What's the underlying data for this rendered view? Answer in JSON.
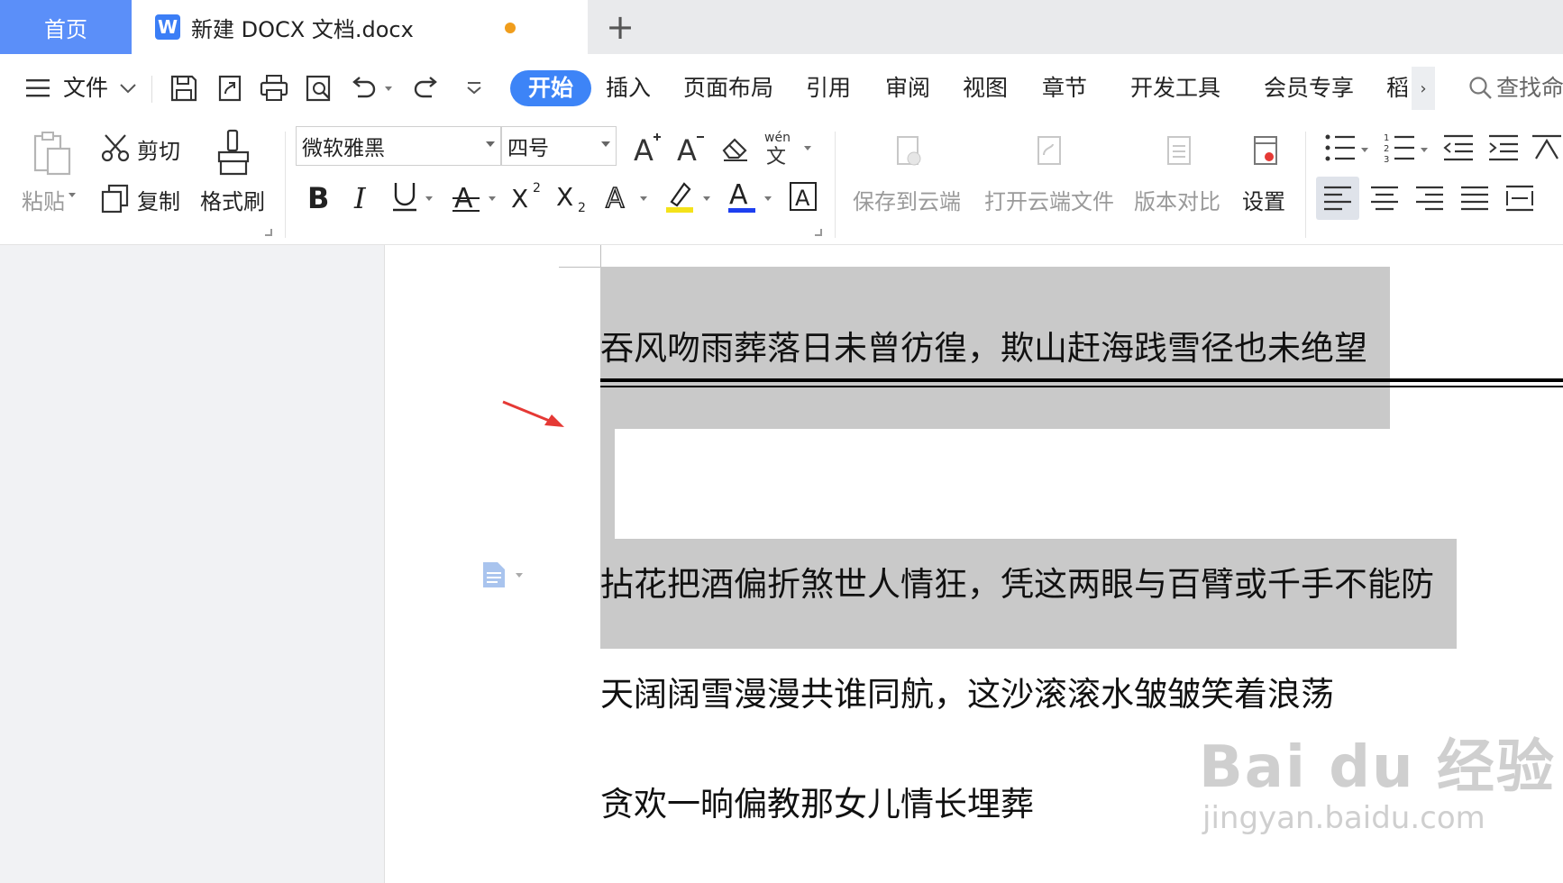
{
  "tabs": {
    "home": "首页",
    "document": "新建 DOCX 文档.docx",
    "add": "+"
  },
  "menu": {
    "file": "文件",
    "ribbon_tabs": [
      "开始",
      "插入",
      "页面布局",
      "引用",
      "审阅",
      "视图",
      "章节",
      "开发工具",
      "会员专享",
      "稻"
    ],
    "search": "查找命"
  },
  "ribbon": {
    "paste": "粘贴",
    "cut": "剪切",
    "copy": "复制",
    "format_painter": "格式刷",
    "font_name": "微软雅黑",
    "font_size": "四号",
    "save_cloud": "保存到云端",
    "open_cloud": "打开云端文件",
    "version_compare": "版本对比",
    "settings": "设置"
  },
  "document": {
    "lines": [
      "吞风吻雨葬落日未曾彷徨，欺山赶海践雪径也未绝望",
      "拈花把酒偏折煞世人情狂，凭这两眼与百臂或千手不能防",
      "天阔阔雪漫漫共谁同航，这沙滚滚水皱皱笑着浪荡",
      "贪欢一晌偏教那女儿情长埋葬"
    ]
  },
  "watermark": {
    "main": "Bai du 经验",
    "sub": "jingyan.baidu.com"
  },
  "colors": {
    "accent": "#3d84f7",
    "home_tab": "#5b8ff9",
    "selection": "#c9c9c9",
    "unsaved_dot": "#f09d1c",
    "arrow": "#e53935"
  }
}
